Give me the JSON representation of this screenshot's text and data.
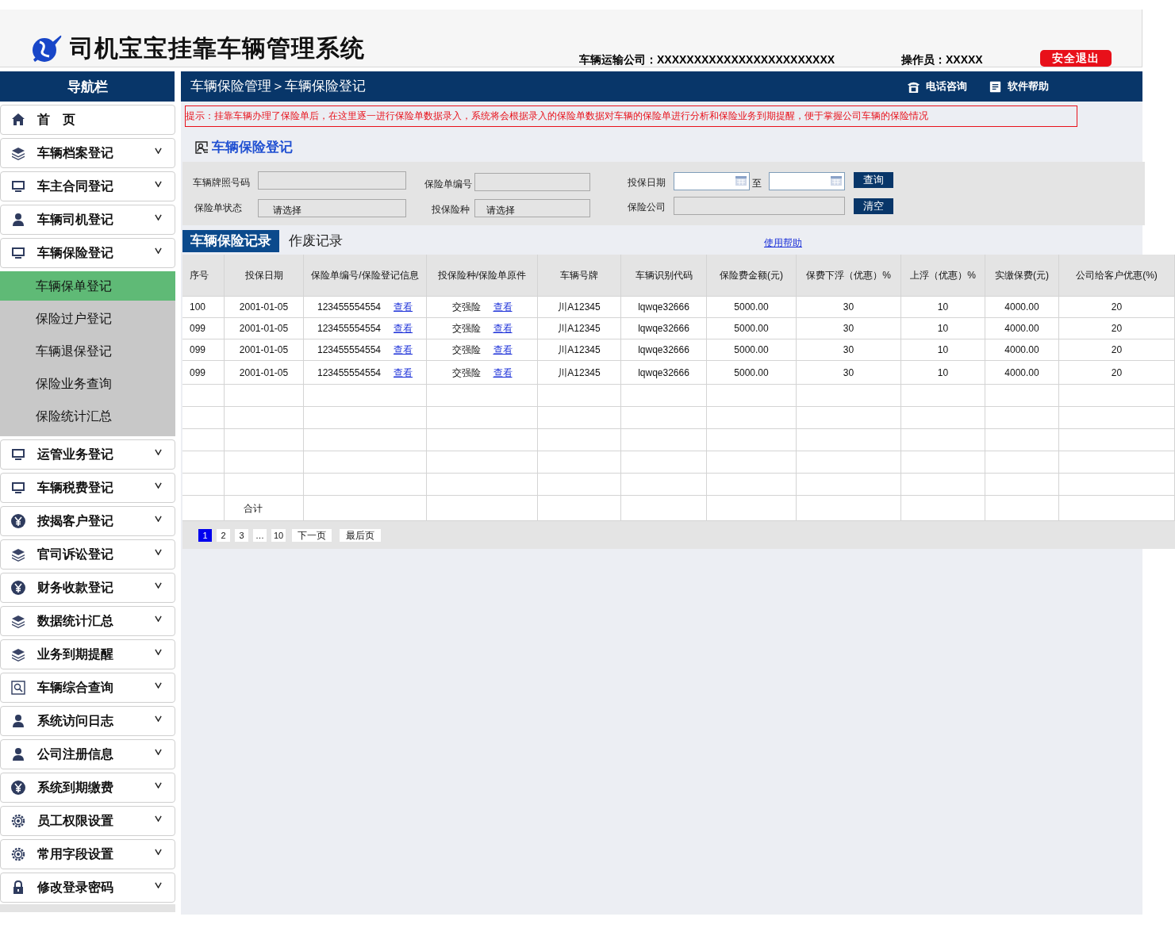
{
  "header": {
    "title": "司机宝宝挂靠车辆管理系统",
    "company": "车辆运输公司：XXXXXXXXXXXXXXXXXXXXXXXX",
    "operator": "操作员：XXXXX",
    "logout": "安全退出"
  },
  "nav": {
    "title": "导航栏",
    "items": [
      {
        "label": "首　页",
        "kind": "home"
      },
      {
        "label": "车辆档案登记",
        "kind": "layers"
      },
      {
        "label": "车主合同登记",
        "kind": "monitor"
      },
      {
        "label": "车辆司机登记",
        "kind": "user"
      },
      {
        "label": "车辆保险登记",
        "kind": "monitor",
        "children": [
          {
            "label": "车辆保单登记",
            "selected": true
          },
          {
            "label": "保险过户登记",
            "selected": false
          },
          {
            "label": "车辆退保登记",
            "selected": false
          },
          {
            "label": "保险业务查询",
            "selected": false
          },
          {
            "label": "保险统计汇总",
            "selected": false
          }
        ]
      },
      {
        "label": "运管业务登记",
        "kind": "monitor"
      },
      {
        "label": "车辆税费登记",
        "kind": "monitor"
      },
      {
        "label": "按揭客户登记",
        "kind": "yen"
      },
      {
        "label": "官司诉讼登记",
        "kind": "layers"
      },
      {
        "label": "财务收款登记",
        "kind": "yen"
      },
      {
        "label": "数据统计汇总",
        "kind": "layers"
      },
      {
        "label": "业务到期提醒",
        "kind": "layers"
      },
      {
        "label": "车辆综合查询",
        "kind": "search"
      },
      {
        "label": "系统访问日志",
        "kind": "user"
      },
      {
        "label": "公司注册信息",
        "kind": "user"
      },
      {
        "label": "系统到期缴费",
        "kind": "yen"
      },
      {
        "label": "员工权限设置",
        "kind": "gear"
      },
      {
        "label": "常用字段设置",
        "kind": "gear"
      },
      {
        "label": "修改登录密码",
        "kind": "lock"
      }
    ]
  },
  "breadcrumb": "车辆保险管理＞车辆保险登记",
  "top_links": [
    {
      "label": "电话咨询",
      "kind": "phone"
    },
    {
      "label": "软件帮助",
      "kind": "doc"
    }
  ],
  "notice": "提示：挂靠车辆办理了保险单后，在这里逐一进行保险单数据录入，系统将会根据录入的保险单数据对车辆的保险单进行分析和保险业务到期提醒，便于掌握公司车辆的保险情况",
  "section_title": "车辆保险登记",
  "filters": {
    "plate_label": "车辆牌照号码",
    "policy_no_label": "保险单编号",
    "date_label": "投保日期",
    "date_sep": "至",
    "status_label": "保险单状态",
    "status_value": "请选择",
    "type_label": "投保险种",
    "type_value": "请选择",
    "company_label": "保险公司",
    "search": "查询",
    "clear": "清空"
  },
  "tabs": [
    {
      "label": "车辆保险记录",
      "selected": true
    },
    {
      "label": "作废记录",
      "selected": false
    }
  ],
  "help_link": "使用帮助",
  "table": {
    "columns": [
      "序号",
      "投保日期",
      "保险单编号/保险登记信息",
      "投保险种/保险单原件",
      "车辆号牌",
      "车辆识别代码",
      "保险费金额(元)",
      "保费下浮（优惠）%",
      "上浮（优惠）%",
      "实缴保费(元)",
      "公司给客户优惠(%)"
    ],
    "rows": [
      {
        "kind": "data",
        "cells": [
          "100",
          "2001-01-05",
          "123455554554",
          "交强险",
          "川A12345",
          "lqwqe32666",
          "5000.00",
          "30",
          "10",
          "4000.00",
          "20"
        ],
        "links": [
          "查看",
          "查看"
        ]
      },
      {
        "kind": "data",
        "cells": [
          "099",
          "2001-01-05",
          "123455554554",
          "交强险",
          "川A12345",
          "lqwqe32666",
          "5000.00",
          "30",
          "10",
          "4000.00",
          "20"
        ],
        "links": [
          "查看",
          "查看"
        ]
      },
      {
        "kind": "data",
        "cells": [
          "099",
          "2001-01-05",
          "123455554554",
          "交强险",
          "川A12345",
          "lqwqe32666",
          "5000.00",
          "30",
          "10",
          "4000.00",
          "20"
        ],
        "links": [
          "查看",
          "查看"
        ]
      },
      {
        "kind": "data",
        "cells": [
          "099",
          "2001-01-05",
          "123455554554",
          "交强险",
          "川A12345",
          "lqwqe32666",
          "5000.00",
          "30",
          "10",
          "4000.00",
          "20"
        ],
        "links": [
          "查看",
          "查看"
        ]
      },
      {
        "kind": "blank"
      },
      {
        "kind": "blank"
      },
      {
        "kind": "blank"
      },
      {
        "kind": "blank"
      },
      {
        "kind": "blank"
      },
      {
        "kind": "total",
        "label": "合计"
      }
    ]
  },
  "pagination": {
    "pages": [
      {
        "label": "1",
        "selected": true
      },
      {
        "label": "2",
        "selected": false
      },
      {
        "label": "3",
        "selected": false
      },
      {
        "label": "…",
        "selected": false
      },
      {
        "label": "10",
        "selected": false
      }
    ],
    "next": "下一页",
    "last": "最后页"
  }
}
